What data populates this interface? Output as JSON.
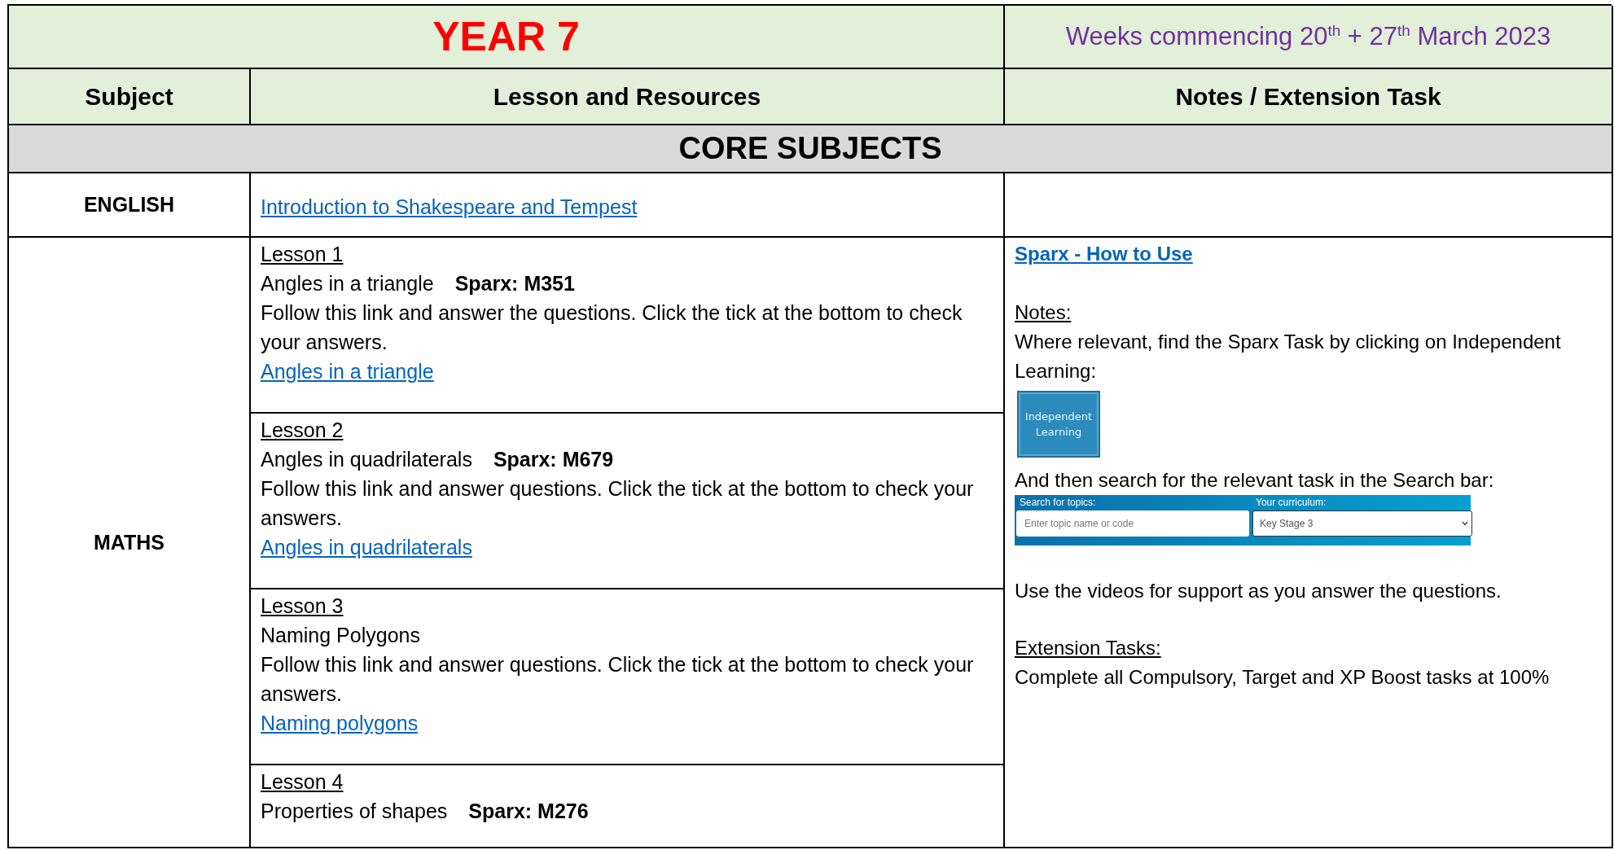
{
  "header": {
    "title": "YEAR 7",
    "weeks": "Weeks commencing 20$^{th}$ + 27$^{th}$ March 2023"
  },
  "columns": [
    "Subject",
    "Lesson and Resources",
    "Notes / Extension Task"
  ],
  "section": "CORE SUBJECTS",
  "rows": [
    {
      "subject": "ENGLISH",
      "lessons": [
        {
          "link": "Introduction to Shakespeare and Tempest"
        }
      ],
      "notes": []
    },
    {
      "subject": "MATHS",
      "lessons": [
        {
          "heading": "Lesson 1",
          "title": "Angles in a triangle",
          "sparx": "Sparx: M351",
          "instructions": "Follow this link and answer the questions. Click the tick at the bottom to check your answers.",
          "link": "Angles in a triangle"
        },
        {
          "heading": "Lesson 2",
          "title": "Angles in quadrilaterals",
          "sparx": "Sparx: M679",
          "instructions": "Follow this link and answer questions. Click the tick at the bottom to check your answers.",
          "link": "Angles in quadrilaterals"
        },
        {
          "heading": "Lesson 3",
          "title": "Naming Polygons",
          "instructions": "Follow this link and answer questions. Click the tick at the bottom to check your answers.",
          "link": "Naming polygons"
        },
        {
          "heading": "Lesson 4",
          "title": "Properties of shapes",
          "sparx": "Sparx: M276"
        }
      ],
      "notes": [
        {
          "kind": "link",
          "text": "Sparx - How to Use"
        },
        {
          "kind": "heading",
          "text": "Notes:"
        },
        {
          "kind": "text",
          "text": "Where relevant, find the Sparx Task by clicking on Independent Learning:"
        },
        {
          "kind": "tile",
          "text": "Independent Learning"
        },
        {
          "kind": "text",
          "text": "And then search for the relevant task in the Search bar:"
        },
        {
          "kind": "searchbar",
          "label": "Search for topics:",
          "placeholder": "Enter topic name or code",
          "select_label": "Your curriculum:",
          "select_value": "Key Stage 3"
        },
        {
          "kind": "text",
          "text": "Use the videos for support as you answer the questions."
        },
        {
          "kind": "heading",
          "text": "Extension Tasks:"
        },
        {
          "kind": "text",
          "text": "Complete all Compulsory, Target and XP Boost tasks at 100%"
        }
      ]
    }
  ]
}
